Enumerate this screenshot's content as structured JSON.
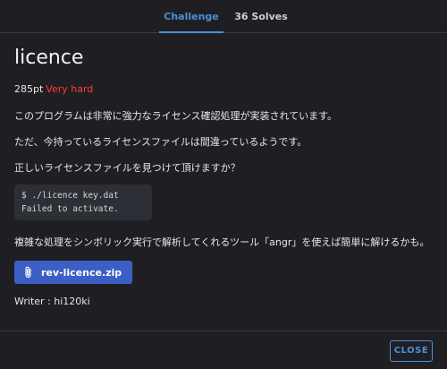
{
  "tabs": [
    {
      "label": "Challenge",
      "active": true
    },
    {
      "label": "36 Solves",
      "active": false
    }
  ],
  "challenge": {
    "title": "licence",
    "points": "285pt",
    "difficulty": "Very hard",
    "description": [
      "このプログラムは非常に強力なライセンス確認処理が実装されています。",
      "ただ、今持っているライセンスファイルは間違っているようです。",
      "正しいライセンスファイルを見つけて頂けますか？"
    ],
    "code_lines": [
      "$ ./licence key.dat",
      "Failed to activate."
    ],
    "hint": "複雑な処理をシンボリック実行で解析してくれるツール「angr」を使えば簡単に解けるかも。",
    "file": {
      "name": "rev-licence.zip",
      "icon": "paperclip-icon"
    },
    "writer": "Writer : hi120ki"
  },
  "footer": {
    "close_label": "CLOSE"
  },
  "colors": {
    "accent": "#4a90d9",
    "difficulty": "#ff3b30",
    "file_button": "#3b5fc5",
    "background": "#1f1f23"
  }
}
